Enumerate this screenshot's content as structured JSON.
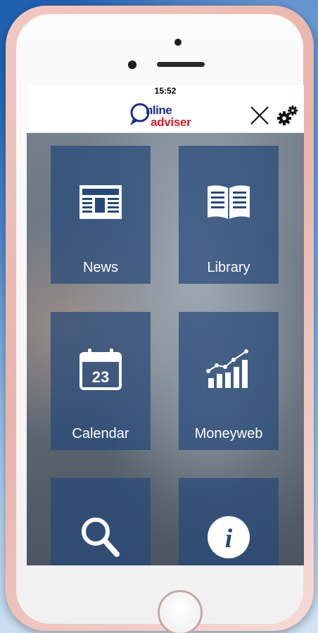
{
  "status_bar": {
    "time": "15:52"
  },
  "header": {
    "logo_line1": "nline",
    "logo_line2": "adviser",
    "close_icon": "close-icon",
    "settings_icon": "gears-icon"
  },
  "tiles": [
    {
      "label": "News",
      "icon": "newspaper-icon"
    },
    {
      "label": "Library",
      "icon": "book-icon"
    },
    {
      "label": "Calendar",
      "icon": "calendar-icon",
      "icon_text": "23"
    },
    {
      "label": "Moneyweb",
      "icon": "growth-chart-icon"
    },
    {
      "label": "",
      "icon": "search-icon"
    },
    {
      "label": "",
      "icon": "info-icon",
      "icon_text": "i"
    }
  ],
  "colors": {
    "tile_bg": "#264878",
    "logo_blue": "#1b2f86",
    "logo_red": "#d0202a",
    "phone_frame": "#e9b3aa"
  }
}
